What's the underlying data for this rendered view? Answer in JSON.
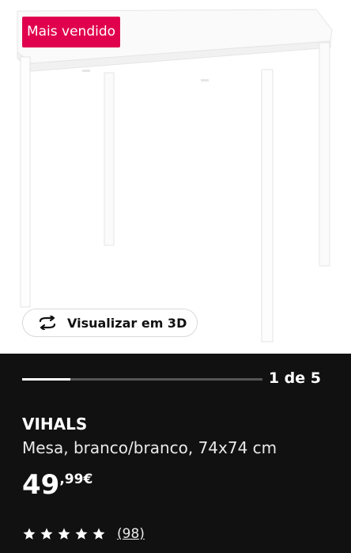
{
  "badge": {
    "label": "Mais vendido"
  },
  "view3d": {
    "label": "Visualizar em 3D",
    "icon": "rotate-3d-icon"
  },
  "gallery": {
    "pager_text": "1 de 5",
    "progress_fraction": 0.2
  },
  "product": {
    "name": "VIHALS",
    "description": "Mesa, branco/branco, 74x74 cm",
    "price": {
      "integer": "49",
      "decimal": ",99",
      "currency": "€"
    },
    "rating": {
      "stars": 5,
      "reviews_text": "(98)"
    }
  },
  "colors": {
    "badge": "#e0004d",
    "dark_panel": "#111111",
    "table": "#ffffff"
  }
}
